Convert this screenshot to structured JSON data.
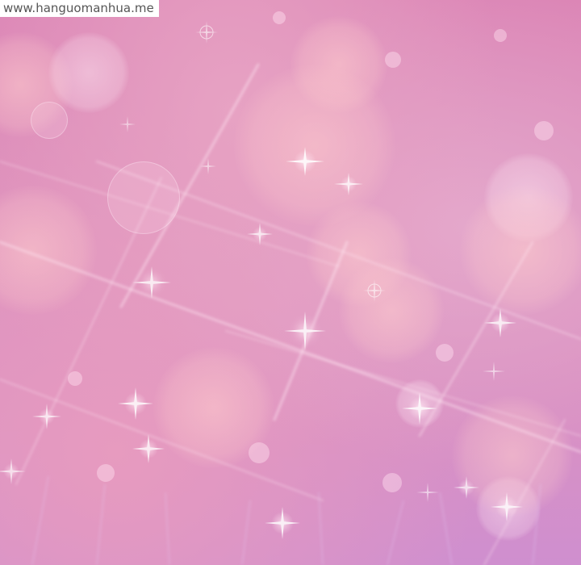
{
  "watermark": {
    "text": "www.hanguomanhua.me"
  },
  "colors": {
    "background": "#dc8cbb",
    "glow": "#ffe6f0",
    "bokeh_warm": "#ffcdcd"
  }
}
